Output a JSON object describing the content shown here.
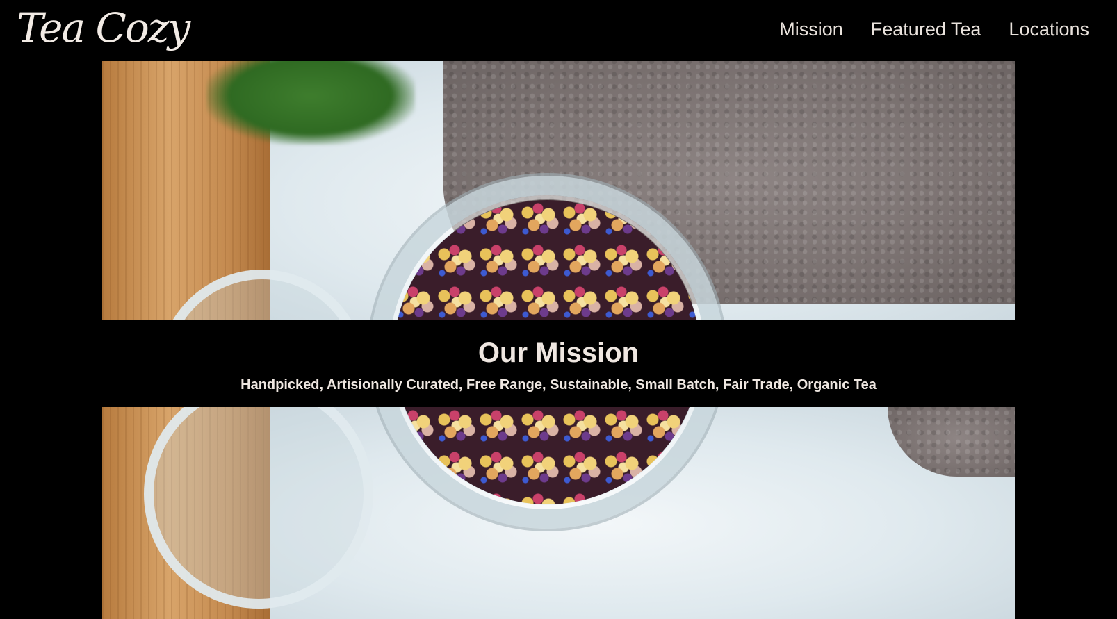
{
  "header": {
    "logo": "Tea Cozy",
    "nav": [
      {
        "label": "Mission"
      },
      {
        "label": "Featured Tea"
      },
      {
        "label": "Locations"
      }
    ]
  },
  "mission": {
    "title": "Our Mission",
    "tagline": "Handpicked, Artisionally Curated, Free Range, Sustainable, Small Batch, Fair Trade, Organic Tea"
  },
  "colors": {
    "background": "#000000",
    "text": "#efe7e1"
  }
}
